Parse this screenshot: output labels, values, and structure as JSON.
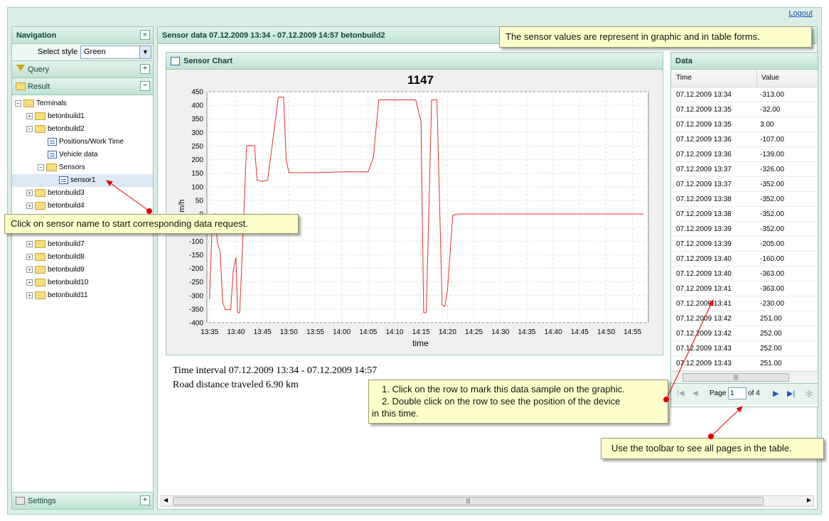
{
  "header": {
    "logout": "Logout"
  },
  "navigation": {
    "title": "Navigation",
    "select_style_label": "Select style",
    "select_style_value": "Green",
    "query_label": "Query",
    "result_label": "Result",
    "settings_label": "Settings",
    "tree": {
      "root": "Terminals",
      "items": [
        "betonbuild1",
        "betonbuild2",
        "Positions/Work Time",
        "Vehicle data",
        "Sensors",
        "sensor1",
        "betonbuild3",
        "betonbuild4",
        "betonbuild7",
        "betonbuild8",
        "betonbuild9",
        "betonbuild10",
        "betonbuild11"
      ]
    }
  },
  "main": {
    "title": "Sensor data 07.12.2009 13:34 - 07.12.2009 14:57 betonbuild2",
    "chart_panel_title": "Sensor Chart",
    "time_interval": "Time interval 07.12.2009 13:34 - 07.12.2009 14:57",
    "road_distance": "Road distance traveled 6.90 km"
  },
  "chart_data": {
    "type": "line",
    "title": "1147",
    "xlabel": "time",
    "ylabel": "m/h",
    "ylim": [
      -400,
      450
    ],
    "xlim": [
      "13:35",
      "14:57"
    ],
    "yticks": [
      450,
      400,
      350,
      300,
      250,
      200,
      150,
      100,
      50,
      0,
      -50,
      -100,
      -150,
      -200,
      -250,
      -300,
      -350,
      -400
    ],
    "xticks": [
      "13:35",
      "13:40",
      "13:45",
      "13:50",
      "13:55",
      "14:00",
      "14:05",
      "14:10",
      "14:15",
      "14:20",
      "14:25",
      "14:30",
      "14:35",
      "14:40",
      "14:45",
      "14:50",
      "14:55"
    ],
    "grid": true,
    "color": "#e8302a",
    "points": [
      [
        "13:35",
        -313
      ],
      [
        "13:35.5",
        -32
      ],
      [
        "13:36",
        3
      ],
      [
        "13:36.5",
        -107
      ],
      [
        "13:37",
        -139
      ],
      [
        "13:37.5",
        -326
      ],
      [
        "13:38",
        -352
      ],
      [
        "13:39",
        -352
      ],
      [
        "13:39.5",
        -205
      ],
      [
        "13:40",
        -160
      ],
      [
        "13:40.3",
        -363
      ],
      [
        "13:40.7",
        -363
      ],
      [
        "13:41",
        -230
      ],
      [
        "13:42",
        251
      ],
      [
        "13:43",
        252
      ],
      [
        "13:43.5",
        251
      ],
      [
        "13:44",
        125
      ],
      [
        "13:45",
        120
      ],
      [
        "13:46",
        125
      ],
      [
        "13:48",
        430
      ],
      [
        "13:49",
        430
      ],
      [
        "13:49.5",
        200
      ],
      [
        "13:50",
        152
      ],
      [
        "13:55",
        152
      ],
      [
        "14:00",
        155
      ],
      [
        "14:05",
        155
      ],
      [
        "14:06",
        210
      ],
      [
        "14:07",
        420
      ],
      [
        "14:14",
        420
      ],
      [
        "14:15",
        340
      ],
      [
        "14:15.5",
        -363
      ],
      [
        "14:16",
        -363
      ],
      [
        "14:17",
        420
      ],
      [
        "14:18",
        420
      ],
      [
        "14:19",
        -335
      ],
      [
        "14:19.5",
        -340
      ],
      [
        "14:20",
        -280
      ],
      [
        "14:21",
        -5
      ],
      [
        "14:22",
        0
      ],
      [
        "14:57",
        0
      ]
    ]
  },
  "data_grid": {
    "title": "Data",
    "columns": [
      "Time",
      "Value"
    ],
    "rows": [
      [
        "07.12.2009 13:34",
        "-313.00"
      ],
      [
        "07.12.2009 13:35",
        "-32.00"
      ],
      [
        "07.12.2009 13:35",
        "3.00"
      ],
      [
        "07.12.2009 13:36",
        "-107.00"
      ],
      [
        "07.12.2009 13:36",
        "-139.00"
      ],
      [
        "07.12.2009 13:37",
        "-326.00"
      ],
      [
        "07.12.2009 13:37",
        "-352.00"
      ],
      [
        "07.12.2009 13:38",
        "-352.00"
      ],
      [
        "07.12.2009 13:38",
        "-352.00"
      ],
      [
        "07.12.2009 13:39",
        "-352.00"
      ],
      [
        "07.12.2009 13:39",
        "-205.00"
      ],
      [
        "07.12.2009 13:40",
        "-160.00"
      ],
      [
        "07.12.2009 13:40",
        "-363.00"
      ],
      [
        "07.12.2009 13:41",
        "-363.00"
      ],
      [
        "07.12.2009 13:41",
        "-230.00"
      ],
      [
        "07.12.2009 13:42",
        "251.00"
      ],
      [
        "07.12.2009 13:42",
        "252.00"
      ],
      [
        "07.12.2009 13:43",
        "252.00"
      ],
      [
        "07.12.2009 13:43",
        "251.00"
      ]
    ],
    "pager": {
      "page_label": "Page",
      "page_value": "1",
      "of_label": "of 4"
    }
  },
  "callouts": {
    "top": "The sensor values are represent in graphic and in table forms.",
    "sensor": "Click on sensor name to start corresponding data request.",
    "row_line1": "1. Click on the row to mark this data sample on the graphic.",
    "row_line2": "2. Double click on the row to see the position of the device",
    "row_line3": "in this time.",
    "toolbar": "Use the toolbar to see all pages in the table."
  },
  "colors": {
    "accent": "#bfe3d3",
    "border": "#99c9b5",
    "callout_bg": "#ffffcc",
    "arrow": "#e00000"
  }
}
